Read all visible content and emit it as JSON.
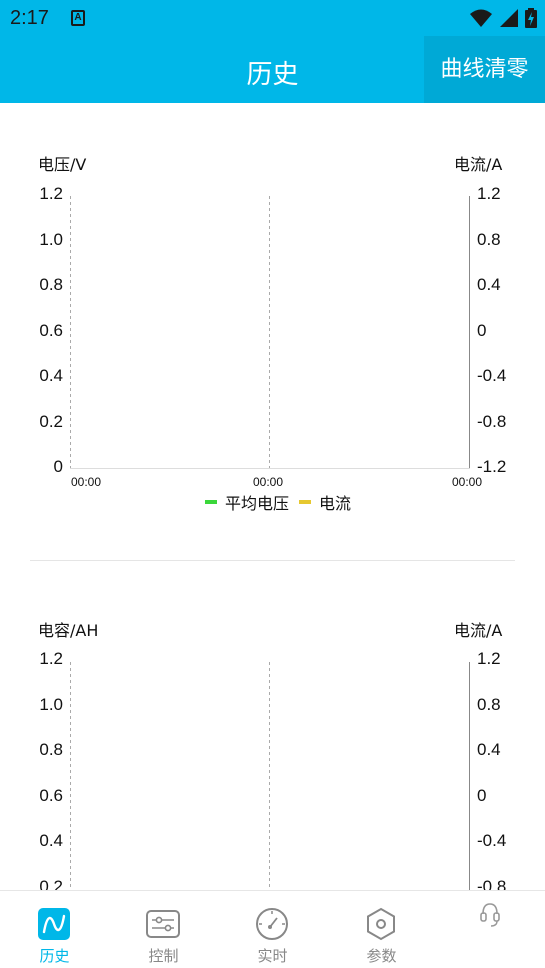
{
  "status_bar": {
    "time": "2:17",
    "notification_icon_letter": "A",
    "icons": [
      "wifi-icon",
      "signal-icon",
      "battery-icon"
    ]
  },
  "app_bar": {
    "title": "历史",
    "clear_button": "曲线清零"
  },
  "colors": {
    "primary": "#00b7e8",
    "avg_voltage": "#3ad73a",
    "current": "#e6c830",
    "inactive": "#888888"
  },
  "chart1": {
    "left_axis_title": "电压/V",
    "right_axis_title": "电流/A",
    "left_ticks": [
      "1.2",
      "1.0",
      "0.8",
      "0.6",
      "0.4",
      "0.2",
      "0"
    ],
    "right_ticks": [
      "1.2",
      "0.8",
      "0.4",
      "0",
      "-0.4",
      "-0.8",
      "-1.2"
    ],
    "x_ticks": [
      "00:00",
      "00:00",
      "00:00"
    ],
    "legend": [
      "平均电压",
      "电流"
    ]
  },
  "chart2": {
    "left_axis_title": "电容/AH",
    "right_axis_title": "电流/A",
    "left_ticks": [
      "1.2",
      "1.0",
      "0.8",
      "0.6",
      "0.4",
      "0.2"
    ],
    "right_ticks": [
      "1.2",
      "0.8",
      "0.4",
      "0",
      "-0.4",
      "-0.8"
    ]
  },
  "chart_data": [
    {
      "type": "line",
      "series": [
        {
          "name": "平均电压",
          "values": []
        },
        {
          "name": "电流",
          "values": []
        }
      ],
      "x": [
        "00:00",
        "00:00",
        "00:00"
      ],
      "ylabel": "电压/V",
      "y2label": "电流/A",
      "ylim": [
        0,
        1.2
      ],
      "y2lim": [
        -1.2,
        1.2
      ]
    },
    {
      "type": "line",
      "series": [],
      "ylabel": "电容/AH",
      "y2label": "电流/A",
      "ylim": [
        0,
        1.2
      ],
      "y2lim": [
        -1.2,
        1.2
      ]
    }
  ],
  "bottom_nav": [
    {
      "label": "历史",
      "icon": "history-curve-icon",
      "active": true
    },
    {
      "label": "控制",
      "icon": "sliders-icon",
      "active": false
    },
    {
      "label": "实时",
      "icon": "gauge-icon",
      "active": false
    },
    {
      "label": "参数",
      "icon": "hex-nut-icon",
      "active": false
    },
    {
      "label": "",
      "icon": "headset-icon",
      "active": false
    }
  ]
}
